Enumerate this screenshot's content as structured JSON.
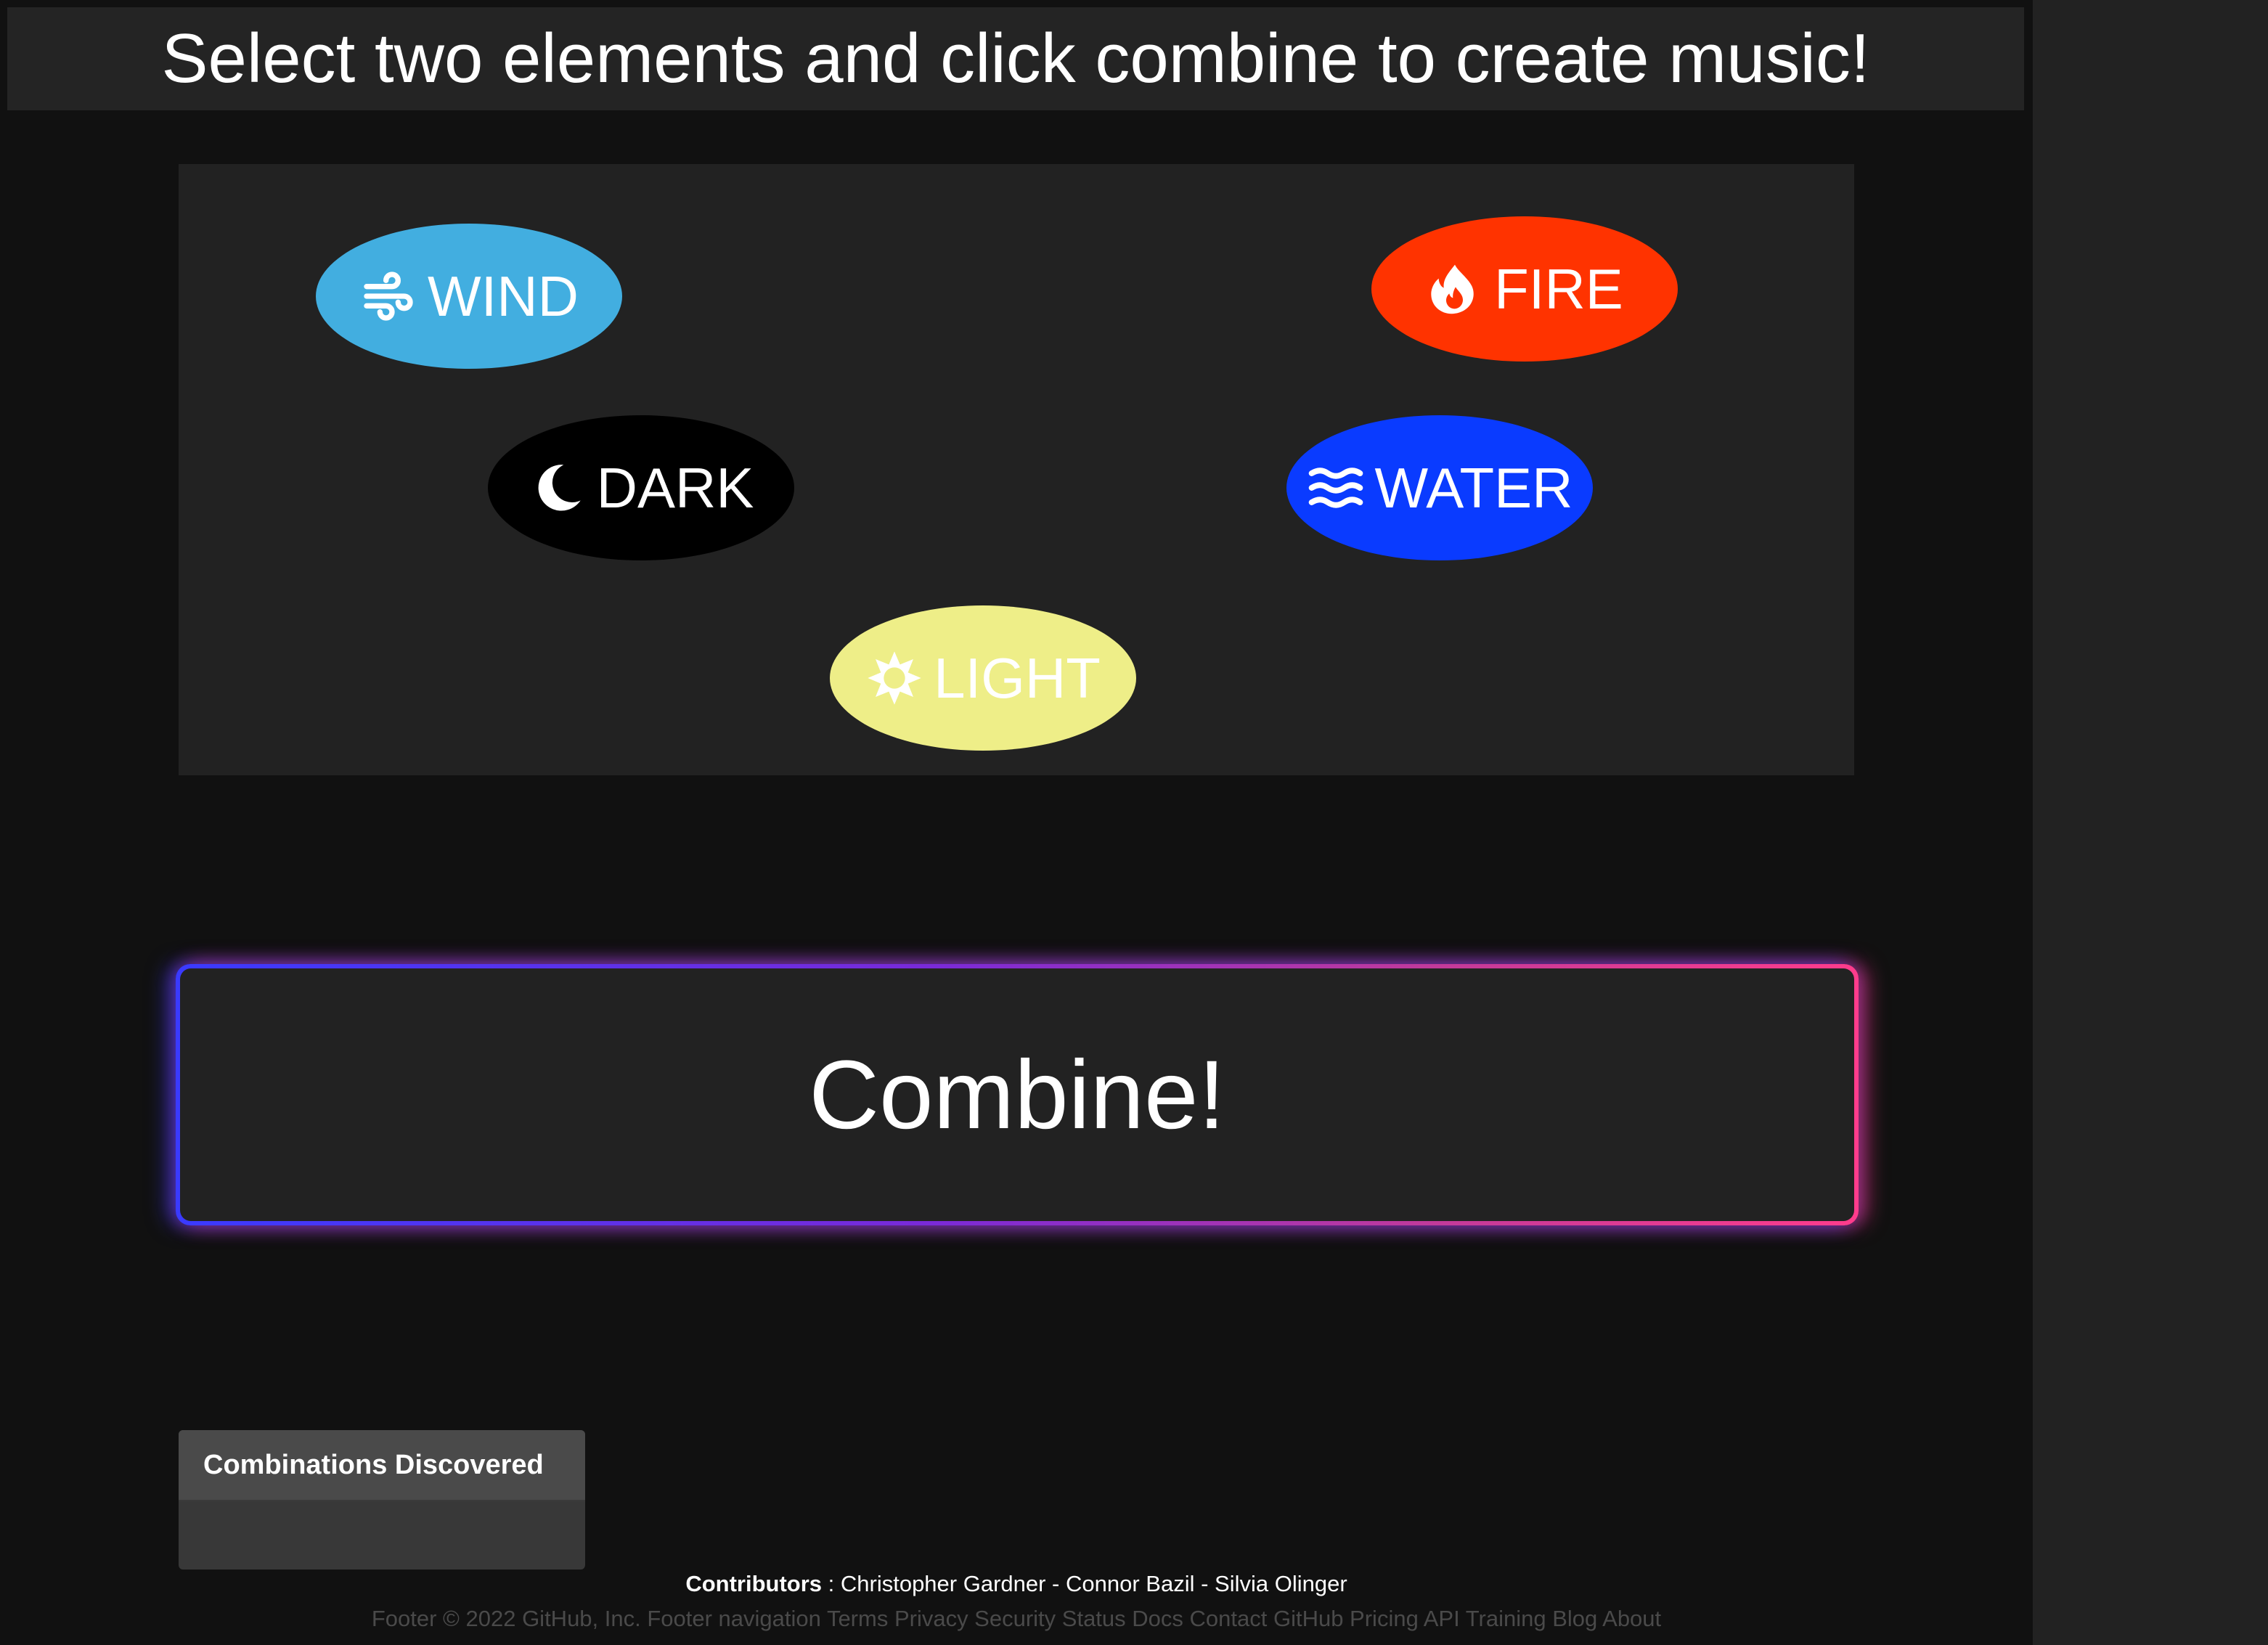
{
  "header": {
    "title": "Select two elements and click combine to create music!"
  },
  "elements": [
    {
      "id": "wind",
      "label": "WIND",
      "icon": "wind-icon",
      "color": "#42aee0",
      "text_color": "#ffffff"
    },
    {
      "id": "fire",
      "label": "FIRE",
      "icon": "fire-icon",
      "color": "#ff3300",
      "text_color": "#ffffff"
    },
    {
      "id": "dark",
      "label": "DARK",
      "icon": "moon-icon",
      "color": "#000000",
      "text_color": "#ffffff"
    },
    {
      "id": "water",
      "label": "WATER",
      "icon": "waves-icon",
      "color": "#0a3bff",
      "text_color": "#ffffff"
    },
    {
      "id": "light",
      "label": "LIGHT",
      "icon": "sun-icon",
      "color": "#eeee88",
      "text_color": "#ffffff"
    }
  ],
  "combine": {
    "label": "Combine!",
    "glow_colors": [
      "#3a3aff",
      "#ff3c8c"
    ]
  },
  "combinations": {
    "title": "Combinations Discovered",
    "items": []
  },
  "contributors": {
    "label": "Contributors",
    "separator": " : ",
    "names": "Christopher Gardner - Connor Bazil - Silvia Olinger"
  },
  "footer": {
    "text": "Footer © 2022 GitHub, Inc. Footer navigation Terms Privacy Security Status Docs Contact GitHub Pricing API Training Blog About"
  },
  "colors": {
    "background": "#111111",
    "panel": "#222222",
    "side_panel": "#222222"
  }
}
